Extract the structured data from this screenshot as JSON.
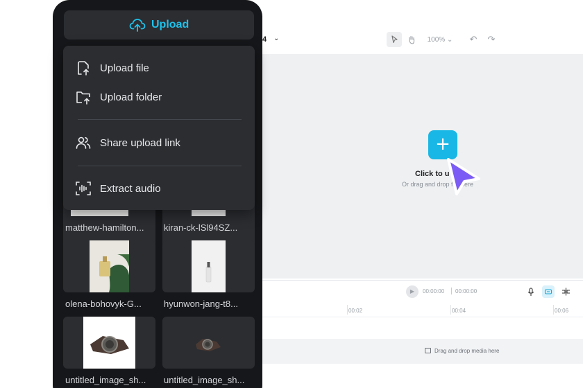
{
  "toolbar": {
    "ratio_label": "4",
    "zoom_label": "100%"
  },
  "canvas": {
    "click_to_upload": "Click to u",
    "drag_drop_hint": "Or drag and drop file here"
  },
  "playback": {
    "current_time": "00:00:00",
    "total_time": "00:00:00"
  },
  "timeline": {
    "ticks": [
      "00:02",
      "00:04",
      "00:06"
    ],
    "drop_hint": "Drag and drop media here"
  },
  "panel": {
    "upload_label": "Upload",
    "menu": [
      {
        "label": "Upload file",
        "icon": "upload-file-icon"
      },
      {
        "label": "Upload folder",
        "icon": "upload-folder-icon"
      },
      {
        "label": "Share upload link",
        "icon": "users-icon"
      },
      {
        "label": "Extract audio",
        "icon": "audio-waveform-icon"
      }
    ],
    "media": [
      {
        "name": "matthew-hamilton..."
      },
      {
        "name": "kiran-ck-lSl94SZ..."
      },
      {
        "name": "olena-bohovyk-G..."
      },
      {
        "name": "hyunwon-jang-t8..."
      },
      {
        "name": "untitled_image_sh..."
      },
      {
        "name": "untitled_image_sh..."
      }
    ]
  },
  "colors": {
    "accent": "#1fc1ea",
    "cursor": "#7b5cf5",
    "panel_bg": "#16171a",
    "menu_bg": "#2b2d31"
  }
}
